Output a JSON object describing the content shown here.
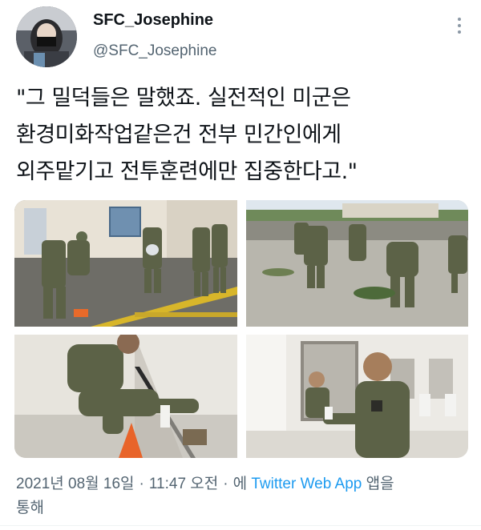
{
  "author": {
    "display_name": "SFC_Josephine",
    "handle": "@SFC_Josephine"
  },
  "tweet": {
    "lines": [
      "\"그 밀덕들은 말했죠. 실전적인 미군은",
      "환경미화작업같은건 전부 민간인에게",
      "외주맡기고 전투훈련에만 집중한다고.\""
    ]
  },
  "media": [
    {
      "name": "soldiers-cleaning-parking-lot"
    },
    {
      "name": "soldiers-clearing-weeds"
    },
    {
      "name": "soldier-scrubbing-floor"
    },
    {
      "name": "soldier-cleaning-mirror"
    }
  ],
  "meta": {
    "date": "2021년 08월 16일",
    "time": "11:47 오전",
    "via_prefix": "에",
    "source": "Twitter Web App",
    "via_suffix_1": "앱을",
    "via_suffix_2": "통해"
  },
  "colors": {
    "text": "#0f1419",
    "secondary": "#536471",
    "link": "#1d9bf0"
  },
  "icons": [
    "more-icon"
  ]
}
